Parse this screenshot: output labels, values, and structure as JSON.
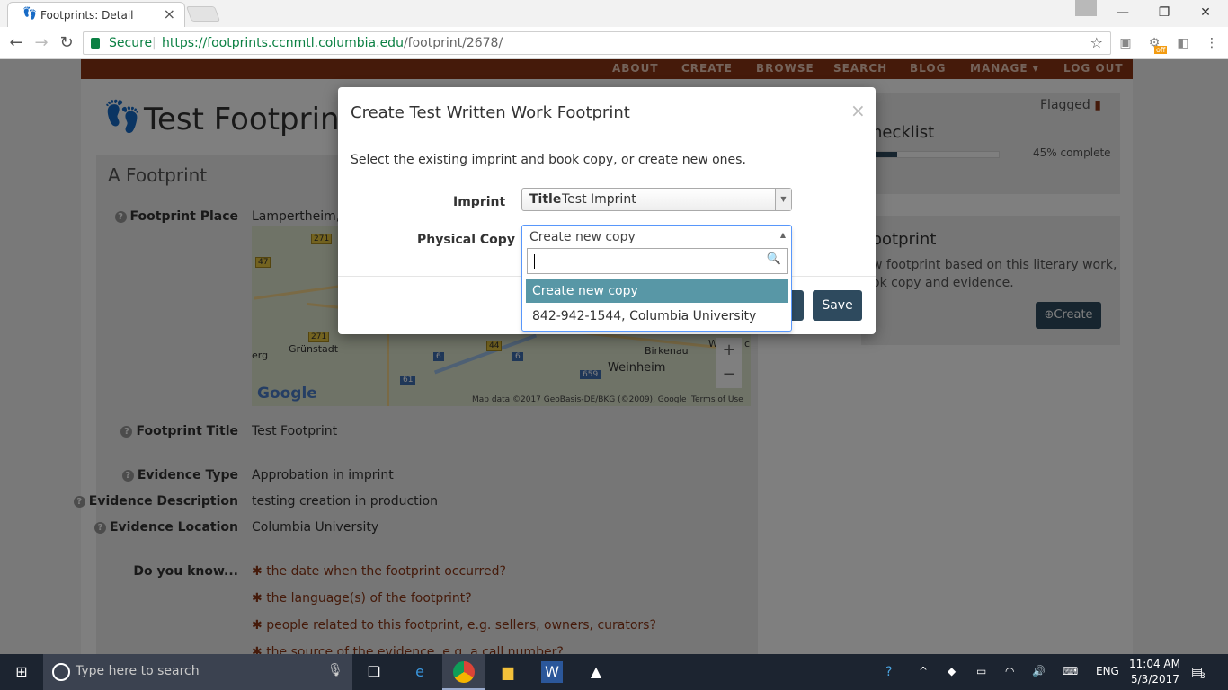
{
  "browser": {
    "tab_title": "Footprints: Detail",
    "tab_close": "×",
    "address": {
      "secure_label": "Secure",
      "separator": "|",
      "url_host": "https://footprints.ccnmtl.columbia.edu",
      "url_path": "/footprint/2678/"
    },
    "ext_badge": "off"
  },
  "site_nav": {
    "links": [
      "ABOUT",
      "CREATE",
      "BROWSE",
      "SEARCH",
      "BLOG",
      "MANAGE ▾",
      "LOG OUT"
    ]
  },
  "page": {
    "title": "Test Footprint",
    "panel_title": "A Footprint",
    "fields": {
      "place_label": "Footprint Place",
      "place_value": "Lampertheim, G",
      "title_label": "Footprint Title",
      "title_value": "Test Footprint",
      "evidence_type_label": "Evidence Type",
      "evidence_type_value": "Approbation in imprint",
      "evidence_desc_label": "Evidence Description",
      "evidence_desc_value": "testing creation in production",
      "evidence_loc_label": "Evidence Location",
      "evidence_loc_value": "Columbia University"
    },
    "map": {
      "labels": [
        "Grünstadt",
        "erg",
        "Birkenau",
        "Weinheim",
        "W",
        "icl"
      ],
      "road_numbers": [
        "271",
        "47",
        "271",
        "44",
        "6",
        "6",
        "61",
        "659"
      ],
      "attribution": "Map data ©2017 GeoBasis-DE/BKG (©2009), Google",
      "terms": "Terms of Use",
      "zoom_in": "+",
      "zoom_out": "−",
      "logo": "Google"
    },
    "do_you_know": {
      "label": "Do you know...",
      "items": [
        "the date when the footprint occurred?",
        "the language(s) of the footprint?",
        "people related to this footprint, e.g. sellers, owners, curators?",
        "the source of the evidence, e.g. a call number?"
      ]
    },
    "sidebar": {
      "flagged": "Flagged",
      "checklist_title": "hecklist",
      "progress_text": "45% complete",
      "progress_fraction": 0.18,
      "new_title": "ootprint",
      "new_text_1": "w footprint based on this literary work,",
      "new_text_2": "ok copy and evidence.",
      "create_button": "Create"
    }
  },
  "modal": {
    "title": "Create Test Written Work Footprint",
    "close": "×",
    "instructions": "Select the existing imprint and book copy, or create new ones.",
    "imprint_label": "Imprint",
    "imprint_bold": "Title",
    "imprint_value": "Test Imprint",
    "copy_label": "Physical Copy",
    "copy_value": "Create new copy",
    "save_button": "Save",
    "dropdown_options": [
      "Create new copy",
      "842-942-1544, Columbia University"
    ]
  },
  "taskbar": {
    "search_placeholder": "Type here to search",
    "lang": "ENG",
    "time": "11:04 AM",
    "date": "5/3/2017",
    "notif_count": "3"
  }
}
